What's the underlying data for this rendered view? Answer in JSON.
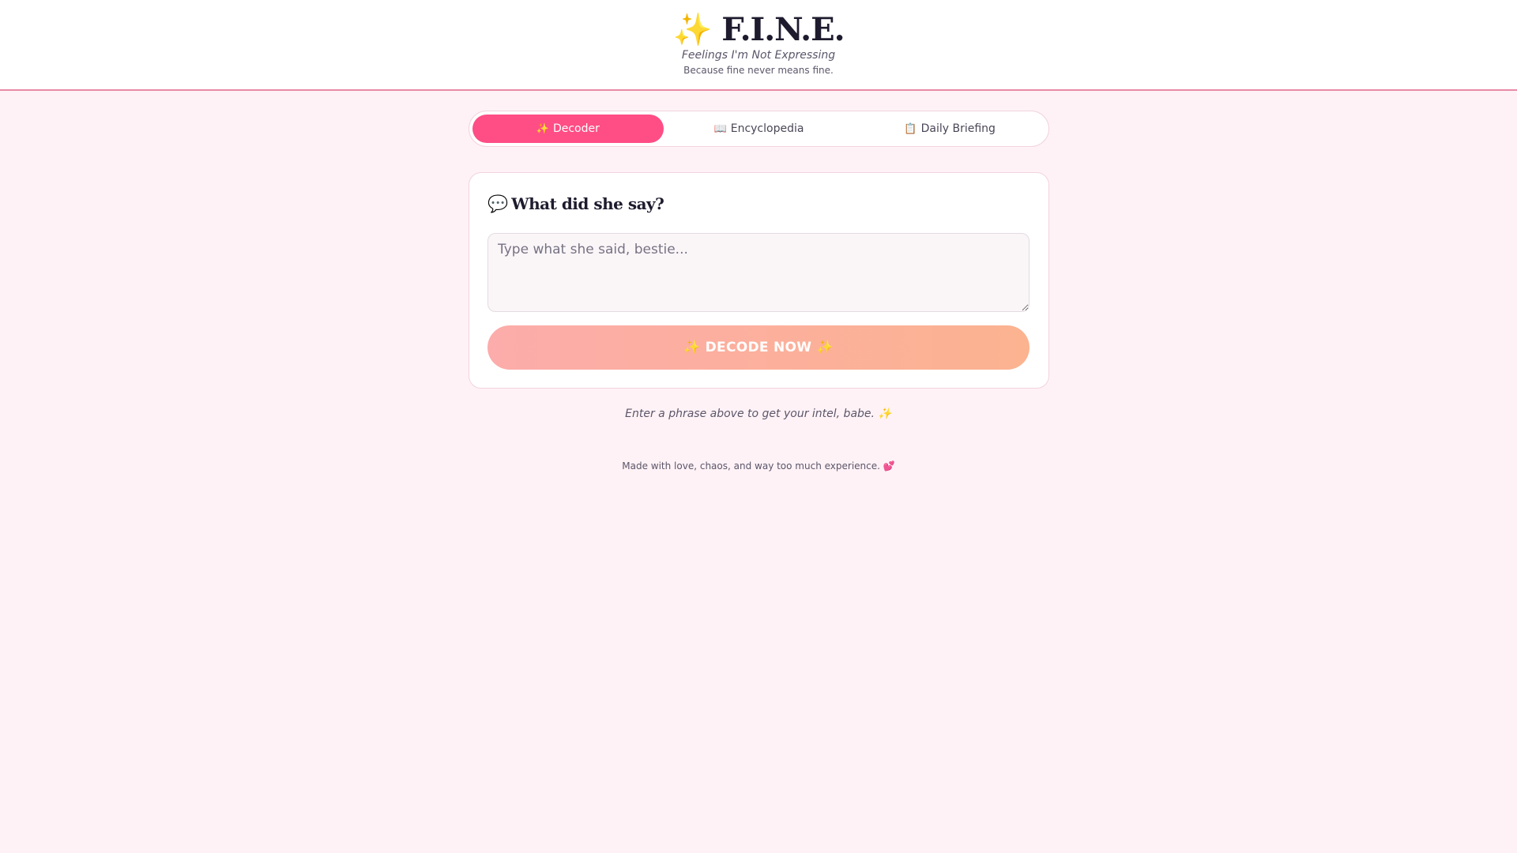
{
  "header": {
    "icon": "sparkles-icon",
    "icon_glyph": "✨",
    "title": "F.I.N.E.",
    "tagline": "Feelings I'm Not Expressing",
    "subtagline": "Because fine never means fine."
  },
  "tabs": [
    {
      "label": "Decoder",
      "icon": "sparkles-icon",
      "glyph": "✨",
      "active": true
    },
    {
      "label": "Encyclopedia",
      "icon": "open-book-icon",
      "glyph": "📖",
      "active": false
    },
    {
      "label": "Daily Briefing",
      "icon": "clipboard-icon",
      "glyph": "📋",
      "active": false
    }
  ],
  "decoder": {
    "heading_icon": "speech-bubble-icon",
    "heading_glyph": "💬",
    "heading": "What did she say?",
    "input_value": "",
    "input_placeholder": "Type what she said, bestie...",
    "button_label": "✨ DECODE NOW ✨"
  },
  "hint": "Enter a phrase above to get your intel, babe. ✨",
  "footer": {
    "text": "Made with love, chaos, and way too much experience.",
    "icon": "two-hearts-icon",
    "glyph": "💕"
  },
  "colors": {
    "accent": "#ff4d85",
    "background": "#fff2f6",
    "button_gradient_start": "#fcacaa",
    "button_gradient_end": "#fbb390",
    "header_border": "#e88aa6"
  }
}
